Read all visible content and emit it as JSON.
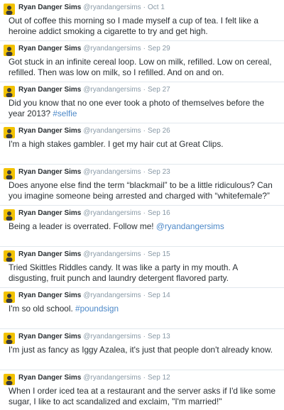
{
  "user": {
    "name": "Ryan Danger Sims",
    "handle": "@ryandangersims",
    "separator": "·"
  },
  "colors": {
    "avatar": "#f2c200",
    "link": "#4c88c8",
    "meta": "#8899a6",
    "text": "#292f33"
  },
  "tweets": [
    {
      "date": "Oct 1",
      "text": "Out of coffee this morning so I made myself a cup of tea. I felt like a heroine addict smoking a cigarette to try and get high.",
      "link": ""
    },
    {
      "date": "Sep 29",
      "text": "Got stuck in an infinite cereal loop. Low on milk, refilled. Low on cereal, refilled. Then was low on milk, so I refilled. And on and on.",
      "link": ""
    },
    {
      "date": "Sep 27",
      "text": "Did you know that no one ever took a photo of themselves before the year 2013? ",
      "link": "#selfie"
    },
    {
      "date": "Sep 26",
      "text": "I'm a high stakes gambler. I get my hair cut at Great Clips.",
      "link": ""
    },
    {
      "date": "Sep 23",
      "text": "Does anyone else find the term “blackmail” to be a little ridiculous? Can you imagine someone being arrested and charged with “whitefemale?”",
      "link": ""
    },
    {
      "date": "Sep 16",
      "text": "Being a leader is overrated. Follow me! ",
      "link": "@ryandangersims"
    },
    {
      "date": "Sep 15",
      "text": "Tried Skittles Riddles candy. It was like a party in my mouth. A disgusting, fruit punch and laundry detergent flavored party.",
      "link": ""
    },
    {
      "date": "Sep 14",
      "text": "I'm so old school. ",
      "link": "#poundsign"
    },
    {
      "date": "Sep 13",
      "text": "I'm just as fancy as Iggy Azalea, it's just that people don't already know.",
      "link": ""
    },
    {
      "date": "Sep 12",
      "text": "When I order iced tea at a restaurant and the server asks if I'd like some sugar, I like to act scandalized and exclaim, \"I'm married!\"",
      "link": ""
    }
  ]
}
